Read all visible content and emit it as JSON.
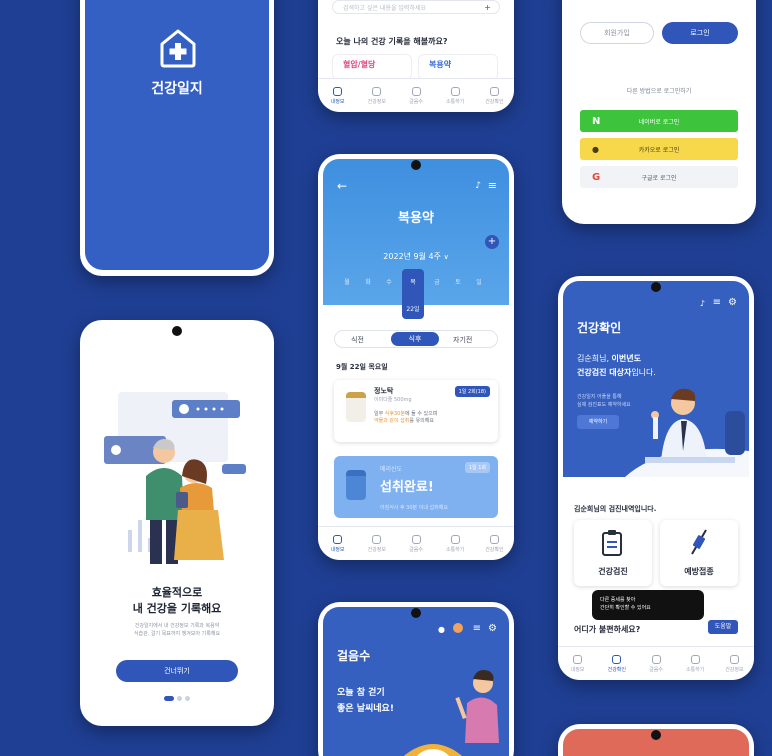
{
  "splash": {
    "title": "건강일지"
  },
  "record_screen": {
    "search_placeholder": "검색하고 싶은 내용을 입력하세요",
    "question": "오늘 나의 건강 기록을 해볼까요?",
    "chips": [
      "혈압/혈당",
      "복용약"
    ],
    "nav": [
      "내정보",
      "건강정보",
      "걸음수",
      "소통하기",
      "건강확인"
    ]
  },
  "login_screen": {
    "signup": "회원가입",
    "login": "로그인",
    "other_label": "다른 방법으로 로그인하기",
    "naver": "네이버로 로그인",
    "kakao": "카카오로 로그인",
    "google": "구글로 로그인",
    "colors": {
      "naver": "#3ec43c",
      "kakao": "#f6d84a",
      "google": "#f2f3f6"
    }
  },
  "medication_screen": {
    "title": "복용약",
    "week": "2022년 9월 4주",
    "days": [
      "월",
      "화",
      "수",
      "목",
      "금",
      "토",
      "일"
    ],
    "selected_date": "22일",
    "meal_tabs": [
      "식전",
      "식후",
      "자기전"
    ],
    "date_label": "9월 22일 목요일",
    "med1": {
      "name": "정노탁",
      "detail": "이미다졸 500mg",
      "badge": "1일 2회(18)",
      "note_line1": "일부 ",
      "note_hl1": "식후30분",
      "note_line1b": "에 둘 수 있으며",
      "note_hl2": "약물과 같이 섭취",
      "note_line2b": "를 유의해요"
    },
    "med2": {
      "name": "메리신도",
      "badge": "1일 1회",
      "done": "섭취완료!",
      "note": "아침식사 후 30분 이내 섭취해요"
    },
    "nav": [
      "내정보",
      "건강정보",
      "걸음수",
      "소통하기",
      "건강확인"
    ]
  },
  "intro_screen": {
    "title_line1": "효율적으로",
    "title_line2": "내 건강을 기록해요",
    "desc_line1": "건강일지에서 내 건강정보 기록과 복용약",
    "desc_line2": "식습관, 걸기 목표까지 챙겨보아 기록해요",
    "button": "건너뛰기"
  },
  "checkup_screen": {
    "title": "건강확인",
    "greeting_prefix": "김순희님, ",
    "greeting_bold": "이번년도",
    "greeting_line2_bold": "건강검진 대상자",
    "greeting_line2_suffix": "입니다.",
    "sub_line1": "건강일지 어플을 통해",
    "sub_line2": "실제 검진표도 예약하세요",
    "reserve_button": "예약하기",
    "history_label": "김순희님의 검진내역입니다.",
    "card1": "건강검진",
    "card2": "예방접종",
    "question": "어디가 불편하세요?",
    "tooltip_line1": "다른 증세를 찾아",
    "tooltip_line2": "간단히 확인할 수 있어요",
    "help_button": "도움말",
    "nav": [
      "내정보",
      "건강확인",
      "걸음수",
      "소통하기",
      "건강정보"
    ]
  },
  "steps_screen": {
    "title": "걸음수",
    "line1": "오늘 참 걷기",
    "line2": "좋은 날씨네요!"
  },
  "colors": {
    "background": "#1f3f94",
    "primary": "#2f56b8",
    "splash": "#3460c4",
    "light_blue": "#4a8fd8"
  }
}
